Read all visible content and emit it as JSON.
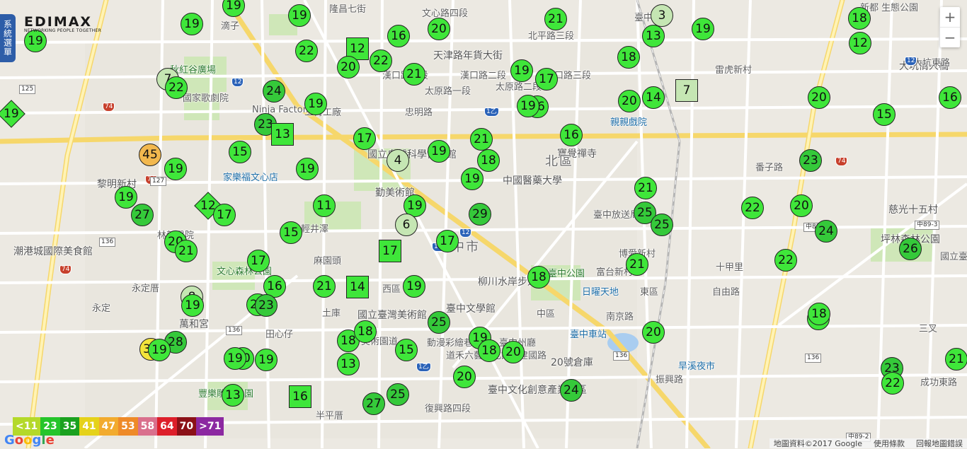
{
  "brand": {
    "name": "EDIMAX",
    "tagline": "NETWORKING PEOPLE TOGETHER"
  },
  "side_tab": {
    "label": "系統選單"
  },
  "zoom": {
    "in": "+",
    "out": "−"
  },
  "legend": [
    {
      "label": "<11",
      "color": "#b4d92a"
    },
    {
      "label": "23",
      "color": "#25c52b"
    },
    {
      "label": "35",
      "color": "#1aa11f"
    },
    {
      "label": "41",
      "color": "#e5d21a"
    },
    {
      "label": "47",
      "color": "#f2ab2e"
    },
    {
      "label": "53",
      "color": "#ee8a28"
    },
    {
      "label": "58",
      "color": "#d9708d"
    },
    {
      "label": "64",
      "color": "#dd1f2a"
    },
    {
      "label": "70",
      "color": "#8b1117"
    },
    {
      "label": ">71",
      "color": "#8c28a1"
    }
  ],
  "attribution": {
    "google": "Google",
    "data": "地圖資料©2017 Google",
    "terms": "使用條款",
    "report": "回報地圖錯誤"
  },
  "place_labels": [
    {
      "text": "滴子",
      "cls": ""
    },
    {
      "text": "隆昌七街",
      "cls": ""
    },
    {
      "text": "文心路四段",
      "cls": ""
    },
    {
      "text": "天津路年貨大街",
      "cls": "big"
    },
    {
      "text": "北平路三段",
      "cls": ""
    },
    {
      "text": "臺中三宮",
      "cls": ""
    },
    {
      "text": "新都 生態公園",
      "cls": ""
    },
    {
      "text": "秋紅谷廣場",
      "cls": "green"
    },
    {
      "text": "國家歌劇院",
      "cls": ""
    },
    {
      "text": "Ninja Factory",
      "cls": ""
    },
    {
      "text": "三菁工廠",
      "cls": ""
    },
    {
      "text": "漢口路四段",
      "cls": ""
    },
    {
      "text": "太原路一段",
      "cls": ""
    },
    {
      "text": "忠明路",
      "cls": ""
    },
    {
      "text": "漢口路二段",
      "cls": ""
    },
    {
      "text": "太原路二段",
      "cls": ""
    },
    {
      "text": "漢口路三段",
      "cls": ""
    },
    {
      "text": "雷虎新村",
      "cls": ""
    },
    {
      "text": "大坑情人橋",
      "cls": "big"
    },
    {
      "text": "親親戲院",
      "cls": "poi"
    },
    {
      "text": "國立自然科學博物館",
      "cls": "big"
    },
    {
      "text": "寶覺禪寺",
      "cls": "big"
    },
    {
      "text": "北區",
      "cls": "district"
    },
    {
      "text": "黎明新村",
      "cls": "big"
    },
    {
      "text": "家樂福文心店",
      "cls": "poi"
    },
    {
      "text": "勤美術館",
      "cls": "big"
    },
    {
      "text": "中國醫藥大學",
      "cls": "big"
    },
    {
      "text": "番子路",
      "cls": ""
    },
    {
      "text": "慈光十五村",
      "cls": "big"
    },
    {
      "text": "坪林森林公園",
      "cls": "big"
    },
    {
      "text": "輕井澤",
      "cls": ""
    },
    {
      "text": "臺中放送局",
      "cls": ""
    },
    {
      "text": "林新醫院",
      "cls": ""
    },
    {
      "text": "潮港城國際美食館",
      "cls": "big"
    },
    {
      "text": "臺中市",
      "cls": "district"
    },
    {
      "text": "博愛新村",
      "cls": ""
    },
    {
      "text": "十甲里",
      "cls": ""
    },
    {
      "text": "國立臺灣科技大學",
      "cls": ""
    },
    {
      "text": "文心森林公園",
      "cls": "green"
    },
    {
      "text": "麻園頭",
      "cls": ""
    },
    {
      "text": "柳川水岸步道",
      "cls": "big"
    },
    {
      "text": "臺中公園",
      "cls": "green"
    },
    {
      "text": "富台新村",
      "cls": ""
    },
    {
      "text": "永定厝",
      "cls": ""
    },
    {
      "text": "西區",
      "cls": ""
    },
    {
      "text": "日曜天地",
      "cls": "poi"
    },
    {
      "text": "東區",
      "cls": ""
    },
    {
      "text": "自由路",
      "cls": ""
    },
    {
      "text": "國立臺灣美術館",
      "cls": "big"
    },
    {
      "text": "臺中文學館",
      "cls": "big"
    },
    {
      "text": "中區",
      "cls": ""
    },
    {
      "text": "南京路",
      "cls": ""
    },
    {
      "text": "萬和宮",
      "cls": "big"
    },
    {
      "text": "田心仔",
      "cls": ""
    },
    {
      "text": "土庫",
      "cls": ""
    },
    {
      "text": "美術園道",
      "cls": ""
    },
    {
      "text": "動漫彩繪巷",
      "cls": ""
    },
    {
      "text": "道禾六藝文化館",
      "cls": ""
    },
    {
      "text": "臺中州廳",
      "cls": ""
    },
    {
      "text": "臺中車站",
      "cls": "poi"
    },
    {
      "text": "旱溪夜市",
      "cls": "poi"
    },
    {
      "text": "三叉",
      "cls": ""
    },
    {
      "text": "20號倉庫",
      "cls": "big"
    },
    {
      "text": "建國路",
      "cls": ""
    },
    {
      "text": "振興路",
      "cls": ""
    },
    {
      "text": "豐樂雕塑公園",
      "cls": "green"
    },
    {
      "text": "臺中文化創意產業園區",
      "cls": "big"
    },
    {
      "text": "半平厝",
      "cls": ""
    },
    {
      "text": "復興路四段",
      "cls": ""
    },
    {
      "text": "成功東路",
      "cls": ""
    },
    {
      "text": "永定",
      "cls": ""
    },
    {
      "text": "大坑東路",
      "cls": ""
    }
  ],
  "markers": [
    {
      "v": "19",
      "shape": "c",
      "color": "#3fe63a"
    },
    {
      "v": "19",
      "shape": "c",
      "color": "#3fe63a"
    },
    {
      "v": "19",
      "shape": "c",
      "color": "#3fe63a"
    },
    {
      "v": "19",
      "shape": "c",
      "color": "#3fe63a"
    },
    {
      "v": "21",
      "shape": "c",
      "color": "#3fe63a"
    },
    {
      "v": "3",
      "shape": "c",
      "color": "#c5e6b3"
    },
    {
      "v": "19",
      "shape": "c",
      "color": "#3fe63a"
    },
    {
      "v": "18",
      "shape": "c",
      "color": "#3fe63a"
    },
    {
      "v": "13",
      "shape": "c",
      "color": "#3fe63a"
    },
    {
      "v": "12",
      "shape": "c",
      "color": "#3fe63a"
    },
    {
      "v": "16",
      "shape": "c",
      "color": "#3fe63a"
    },
    {
      "v": "20",
      "shape": "c",
      "color": "#3fe63a"
    },
    {
      "v": "22",
      "shape": "c",
      "color": "#3fe63a"
    },
    {
      "v": "12",
      "shape": "s",
      "color": "#3fe63a"
    },
    {
      "v": "20",
      "shape": "c",
      "color": "#3fe63a"
    },
    {
      "v": "22",
      "shape": "c",
      "color": "#3fe63a"
    },
    {
      "v": "21",
      "shape": "c",
      "color": "#3fe63a"
    },
    {
      "v": "19",
      "shape": "c",
      "color": "#3fe63a"
    },
    {
      "v": "17",
      "shape": "c",
      "color": "#3fe63a"
    },
    {
      "v": "18",
      "shape": "c",
      "color": "#3fe63a"
    },
    {
      "v": "7",
      "shape": "c",
      "color": "#c5e6b3"
    },
    {
      "v": "22",
      "shape": "c",
      "color": "#3fe63a"
    },
    {
      "v": "24",
      "shape": "c",
      "color": "#35c93a"
    },
    {
      "v": "19",
      "shape": "c",
      "color": "#3fe63a"
    },
    {
      "v": "20",
      "shape": "c",
      "color": "#3fe63a"
    },
    {
      "v": "14",
      "shape": "c",
      "color": "#3fe63a"
    },
    {
      "v": "7",
      "shape": "s",
      "color": "#c5e6b3"
    },
    {
      "v": "20",
      "shape": "c",
      "color": "#3fe63a"
    },
    {
      "v": "16",
      "shape": "c",
      "color": "#3fe63a"
    },
    {
      "v": "19",
      "shape": "d",
      "color": "#3fe63a"
    },
    {
      "v": "23",
      "shape": "c",
      "color": "#35c93a"
    },
    {
      "v": "13",
      "shape": "s",
      "color": "#3fe63a"
    },
    {
      "v": "17",
      "shape": "c",
      "color": "#3fe63a"
    },
    {
      "v": "21",
      "shape": "c",
      "color": "#3fe63a"
    },
    {
      "v": "15",
      "shape": "c",
      "color": "#3fe63a"
    },
    {
      "v": "16",
      "shape": "c",
      "color": "#3fe63a"
    },
    {
      "v": "19",
      "shape": "c",
      "color": "#3fe63a"
    },
    {
      "v": "15",
      "shape": "c",
      "color": "#3fe63a"
    },
    {
      "v": "45",
      "shape": "c",
      "color": "#f2b84e"
    },
    {
      "v": "4",
      "shape": "c",
      "color": "#c5e6b3"
    },
    {
      "v": "19",
      "shape": "c",
      "color": "#3fe63a"
    },
    {
      "v": "18",
      "shape": "c",
      "color": "#3fe63a"
    },
    {
      "v": "19",
      "shape": "c",
      "color": "#3fe63a"
    },
    {
      "v": "19",
      "shape": "c",
      "color": "#3fe63a"
    },
    {
      "v": "19",
      "shape": "c",
      "color": "#3fe63a"
    },
    {
      "v": "23",
      "shape": "c",
      "color": "#35c93a"
    },
    {
      "v": "16",
      "shape": "c",
      "color": "#3fe63a"
    },
    {
      "v": "19",
      "shape": "c",
      "color": "#3fe63a"
    },
    {
      "v": "27",
      "shape": "c",
      "color": "#35c93a"
    },
    {
      "v": "12",
      "shape": "d",
      "color": "#3fe63a"
    },
    {
      "v": "17",
      "shape": "c",
      "color": "#3fe63a"
    },
    {
      "v": "11",
      "shape": "c",
      "color": "#3fe63a"
    },
    {
      "v": "19",
      "shape": "c",
      "color": "#3fe63a"
    },
    {
      "v": "29",
      "shape": "c",
      "color": "#35c93a"
    },
    {
      "v": "21",
      "shape": "c",
      "color": "#3fe63a"
    },
    {
      "v": "25",
      "shape": "c",
      "color": "#35c93a"
    },
    {
      "v": "25",
      "shape": "c",
      "color": "#35c93a"
    },
    {
      "v": "22",
      "shape": "c",
      "color": "#3fe63a"
    },
    {
      "v": "20",
      "shape": "c",
      "color": "#3fe63a"
    },
    {
      "v": "24",
      "shape": "c",
      "color": "#35c93a"
    },
    {
      "v": "15",
      "shape": "c",
      "color": "#3fe63a"
    },
    {
      "v": "6",
      "shape": "c",
      "color": "#c5e6b3"
    },
    {
      "v": "17",
      "shape": "c",
      "color": "#3fe63a"
    },
    {
      "v": "20",
      "shape": "c",
      "color": "#3fe63a"
    },
    {
      "v": "21",
      "shape": "c",
      "color": "#3fe63a"
    },
    {
      "v": "17",
      "shape": "s",
      "color": "#3fe63a"
    },
    {
      "v": "17",
      "shape": "c",
      "color": "#3fe63a"
    },
    {
      "v": "26",
      "shape": "c",
      "color": "#35c93a"
    },
    {
      "v": "22",
      "shape": "c",
      "color": "#3fe63a"
    },
    {
      "v": "21",
      "shape": "c",
      "color": "#3fe63a"
    },
    {
      "v": "18",
      "shape": "c",
      "color": "#3fe63a"
    },
    {
      "v": "16",
      "shape": "c",
      "color": "#3fe63a"
    },
    {
      "v": "21",
      "shape": "c",
      "color": "#3fe63a"
    },
    {
      "v": "14",
      "shape": "s",
      "color": "#3fe63a"
    },
    {
      "v": "19",
      "shape": "c",
      "color": "#3fe63a"
    },
    {
      "v": "8",
      "shape": "c",
      "color": "#c5e6b3"
    },
    {
      "v": "19",
      "shape": "c",
      "color": "#3fe63a"
    },
    {
      "v": "20",
      "shape": "c",
      "color": "#3fe63a"
    },
    {
      "v": "23",
      "shape": "c",
      "color": "#35c93a"
    },
    {
      "v": "35",
      "shape": "c",
      "color": "#f3e43a"
    },
    {
      "v": "20",
      "shape": "c",
      "color": "#3fe63a"
    },
    {
      "v": "20",
      "shape": "c",
      "color": "#3fe63a"
    },
    {
      "v": "18",
      "shape": "c",
      "color": "#3fe63a"
    },
    {
      "v": "28",
      "shape": "c",
      "color": "#35c93a"
    },
    {
      "v": "19",
      "shape": "c",
      "color": "#3fe63a"
    },
    {
      "v": "25",
      "shape": "c",
      "color": "#35c93a"
    },
    {
      "v": "18",
      "shape": "c",
      "color": "#3fe63a"
    },
    {
      "v": "20",
      "shape": "c",
      "color": "#3fe63a"
    },
    {
      "v": "18",
      "shape": "c",
      "color": "#3fe63a"
    },
    {
      "v": "18",
      "shape": "c",
      "color": "#3fe63a"
    },
    {
      "v": "20",
      "shape": "c",
      "color": "#3fe63a"
    },
    {
      "v": "19",
      "shape": "c",
      "color": "#3fe63a"
    },
    {
      "v": "19",
      "shape": "c",
      "color": "#3fe63a"
    },
    {
      "v": "15",
      "shape": "c",
      "color": "#3fe63a"
    },
    {
      "v": "13",
      "shape": "c",
      "color": "#3fe63a"
    },
    {
      "v": "19",
      "shape": "c",
      "color": "#3fe63a"
    },
    {
      "v": "20",
      "shape": "c",
      "color": "#3fe63a"
    },
    {
      "v": "23",
      "shape": "c",
      "color": "#35c93a"
    },
    {
      "v": "21",
      "shape": "c",
      "color": "#3fe63a"
    },
    {
      "v": "13",
      "shape": "c",
      "color": "#3fe63a"
    },
    {
      "v": "16",
      "shape": "s",
      "color": "#3fe63a"
    },
    {
      "v": "22",
      "shape": "c",
      "color": "#3fe63a"
    },
    {
      "v": "27",
      "shape": "c",
      "color": "#35c93a"
    },
    {
      "v": "25",
      "shape": "c",
      "color": "#35c93a"
    },
    {
      "v": "24",
      "shape": "c",
      "color": "#35c93a"
    }
  ],
  "shields": [
    {
      "text": "74",
      "style": "red"
    },
    {
      "text": "74",
      "style": "red"
    },
    {
      "text": "74",
      "style": "red"
    },
    {
      "text": "74",
      "style": "red"
    },
    {
      "text": "12",
      "style": "blue"
    },
    {
      "text": "12",
      "style": "blue"
    },
    {
      "text": "12",
      "style": "blue"
    },
    {
      "text": "1乙",
      "style": "blue"
    },
    {
      "text": "1乙",
      "style": "blue"
    },
    {
      "text": "1乙",
      "style": "blue"
    },
    {
      "text": "125",
      "style": ""
    },
    {
      "text": "127",
      "style": ""
    },
    {
      "text": "136",
      "style": ""
    },
    {
      "text": "136",
      "style": ""
    },
    {
      "text": "136",
      "style": ""
    },
    {
      "text": "136",
      "style": ""
    },
    {
      "text": "中89-3",
      "style": ""
    },
    {
      "text": "中89-3",
      "style": ""
    },
    {
      "text": "中89-2",
      "style": ""
    }
  ]
}
